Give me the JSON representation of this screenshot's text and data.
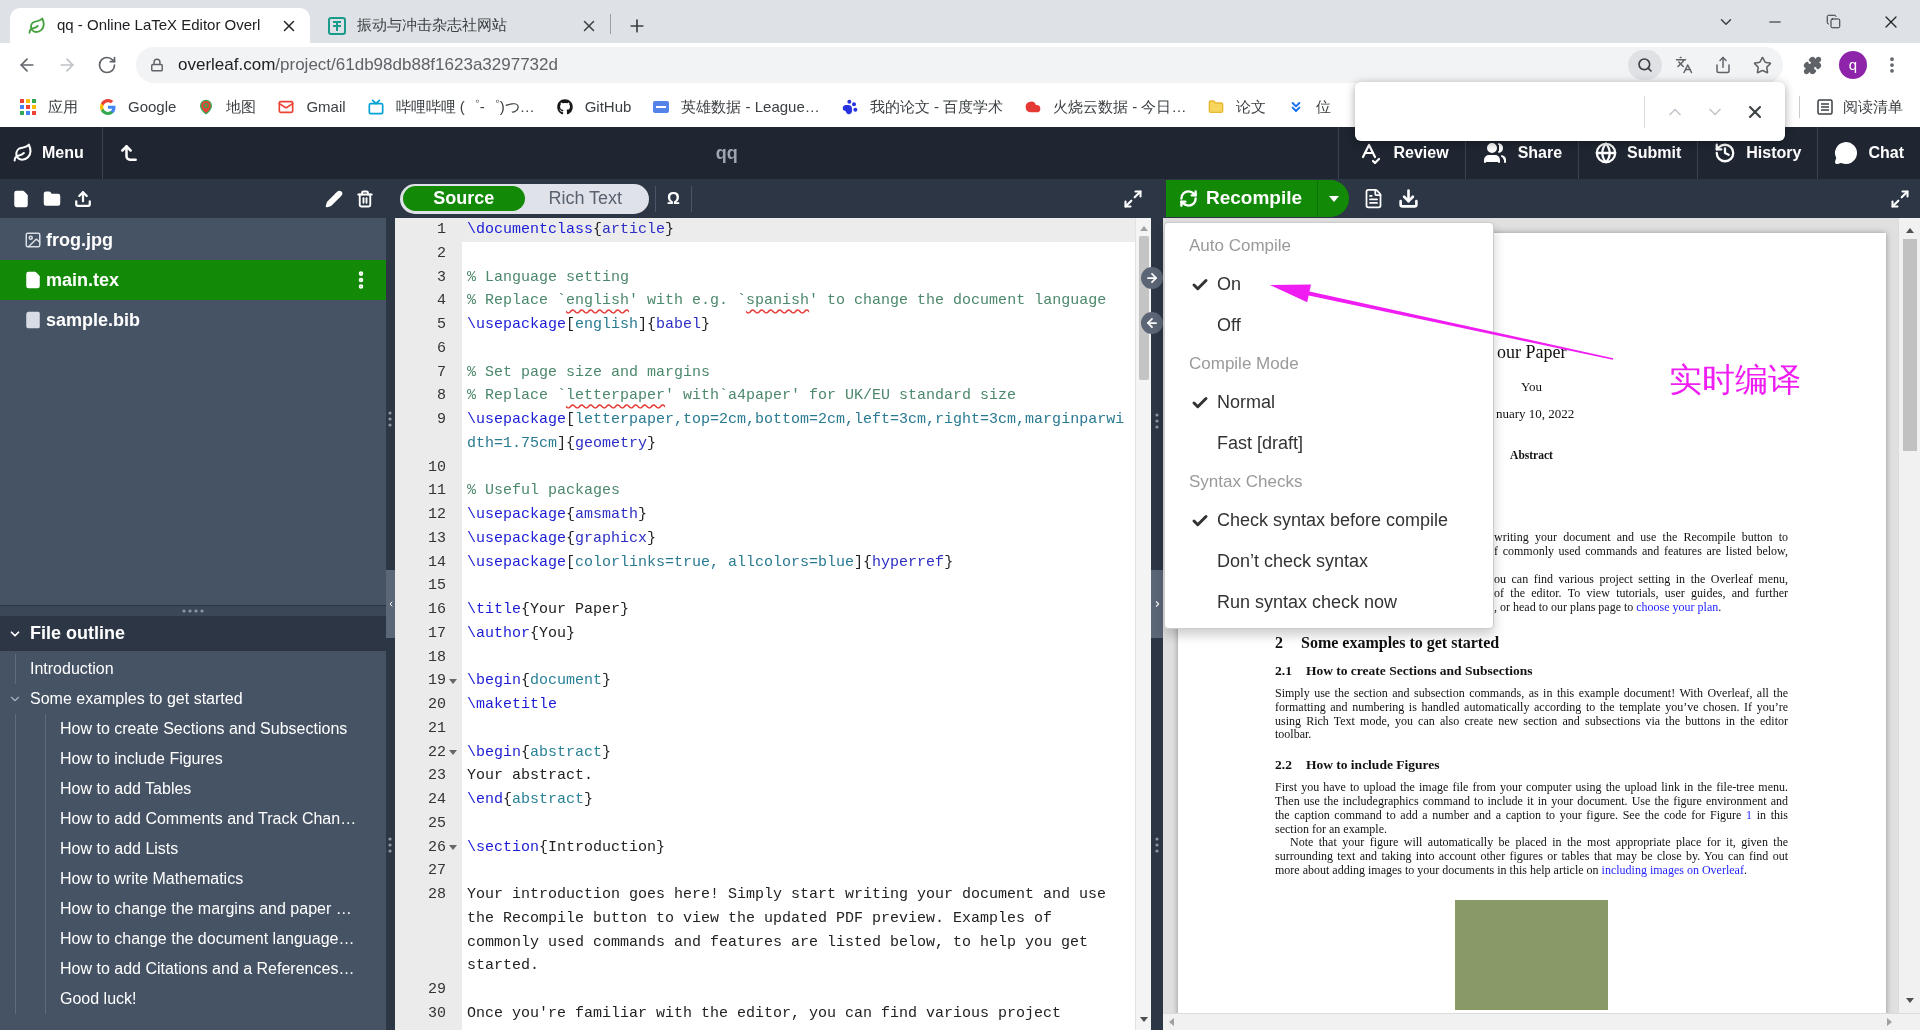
{
  "browser": {
    "tabs": [
      {
        "kind": "leaf",
        "title": "qq - Online LaTeX Editor Overl",
        "selected": true
      },
      {
        "kind": "site",
        "title": "振动与冲击杂志社网站",
        "selected": false
      }
    ],
    "nav_buttons": [
      {
        "kind": "back",
        "disabled": false
      },
      {
        "kind": "forward",
        "disabled": true
      },
      {
        "kind": "reload",
        "disabled": false
      }
    ],
    "url": {
      "host": "overleaf.com",
      "path": "/project/61db98db88f1623a3297732d"
    },
    "profile_initial": "q",
    "bookmarks": [
      {
        "kind": "apps",
        "label": "应用"
      },
      {
        "kind": "google",
        "label": "Google"
      },
      {
        "kind": "maps",
        "label": "地图"
      },
      {
        "kind": "gmail",
        "label": "Gmail"
      },
      {
        "kind": "bilibili",
        "label": "哔哩哔哩 (゜-゜)つ…"
      },
      {
        "kind": "github",
        "label": "GitHub"
      },
      {
        "kind": "opgg",
        "label": "英雄数据 - League…"
      },
      {
        "kind": "baidu",
        "label": "我的论文 - 百度学术"
      },
      {
        "kind": "cloud",
        "label": "火烧云数据 - 今日…"
      },
      {
        "kind": "folder",
        "label": "论文"
      },
      {
        "kind": "chevrons",
        "label": "位"
      }
    ],
    "reading_list": "阅读清单",
    "find_bar": {
      "buttons": [
        {
          "kind": "previous",
          "disabled": true
        },
        {
          "kind": "next",
          "disabled": true
        }
      ]
    }
  },
  "overleaf": {
    "menu_label": "Menu",
    "project_title": "qq",
    "header_buttons": [
      {
        "kind": "review",
        "label": "Review"
      },
      {
        "kind": "share",
        "label": "Share"
      },
      {
        "kind": "submit",
        "label": "Submit"
      },
      {
        "kind": "history",
        "label": "History"
      },
      {
        "kind": "chat",
        "label": "Chat"
      }
    ],
    "file_tree": [
      {
        "kind": "image",
        "name": "frog.jpg",
        "selected": false
      },
      {
        "kind": "tex",
        "name": "main.tex",
        "selected": true
      },
      {
        "kind": "bib",
        "name": "sample.bib",
        "selected": false
      }
    ],
    "outline": {
      "title": "File outline",
      "expanded": true,
      "items": [
        {
          "label": "Introduction"
        },
        {
          "label": "Some examples to get started",
          "expanded": true,
          "children": [
            {
              "label": "How to create Sections and Subsections"
            },
            {
              "label": "How to include Figures"
            },
            {
              "label": "How to add Tables"
            },
            {
              "label": "How to add Comments and Track Chan…"
            },
            {
              "label": "How to add Lists"
            },
            {
              "label": "How to write Mathematics"
            },
            {
              "label": "How to change the margins and paper …"
            },
            {
              "label": "How to change the document language…"
            },
            {
              "label": "How to add Citations and a References…"
            },
            {
              "label": "Good luck!"
            }
          ]
        }
      ]
    },
    "editor_modes": [
      {
        "label": "Source",
        "selected": true
      },
      {
        "label": "Rich Text",
        "selected": false
      }
    ],
    "symbol_button": "Ω",
    "code_lines": [
      {
        "number": "1",
        "current": true,
        "fold": false,
        "tokens": [
          {
            "kind": "cmd",
            "text": "\\documentclass"
          },
          {
            "kind": "brace",
            "text": "{"
          },
          {
            "kind": "pkg",
            "text": "article"
          },
          {
            "kind": "brace",
            "text": "}"
          }
        ]
      },
      {
        "number": "2",
        "current": false,
        "fold": false
      },
      {
        "number": "3",
        "current": false,
        "fold": false,
        "tokens": [
          {
            "kind": "comment",
            "text": "% Language setting"
          }
        ]
      },
      {
        "number": "4",
        "current": false,
        "fold": false,
        "tokens": [
          {
            "kind": "comment",
            "text": "% Replace `"
          },
          {
            "kind": "typo",
            "text": "english"
          },
          {
            "kind": "comment",
            "text": "' with e.g. `"
          },
          {
            "kind": "typo",
            "text": "spanish"
          },
          {
            "kind": "comment",
            "text": "' to change the document language"
          }
        ]
      },
      {
        "number": "5",
        "current": false,
        "fold": false,
        "tokens": [
          {
            "kind": "cmd",
            "text": "\\usepackage"
          },
          {
            "kind": "brace",
            "text": "["
          },
          {
            "kind": "opt",
            "text": "english"
          },
          {
            "kind": "brace",
            "text": "]{"
          },
          {
            "kind": "pkg",
            "text": "babel"
          },
          {
            "kind": "brace",
            "text": "}"
          }
        ]
      },
      {
        "number": "6",
        "current": false,
        "fold": false
      },
      {
        "number": "7",
        "current": false,
        "fold": false,
        "tokens": [
          {
            "kind": "comment",
            "text": "% Set page size and margins"
          }
        ]
      },
      {
        "number": "8",
        "current": false,
        "fold": false,
        "tokens": [
          {
            "kind": "comment",
            "text": "% Replace `"
          },
          {
            "kind": "typo",
            "text": "letterpaper"
          },
          {
            "kind": "comment",
            "text": "' with`a4paper' for UK/EU standard size"
          }
        ]
      },
      {
        "number": "9",
        "current": false,
        "fold": false,
        "tokens": [
          {
            "kind": "cmd",
            "text": "\\usepackage"
          },
          {
            "kind": "brace",
            "text": "["
          },
          {
            "kind": "opt",
            "text": "letterpaper,top=2cm,bottom=2cm,left=3cm,right=3cm,marginparwidth=1.75cm"
          },
          {
            "kind": "brace",
            "text": "]{"
          },
          {
            "kind": "pkg",
            "text": "geometry"
          },
          {
            "kind": "brace",
            "text": "}"
          }
        ]
      },
      {
        "number": "10",
        "current": false,
        "fold": false
      },
      {
        "number": "11",
        "current": false,
        "fold": false,
        "tokens": [
          {
            "kind": "comment",
            "text": "% Useful packages"
          }
        ]
      },
      {
        "number": "12",
        "current": false,
        "fold": false,
        "tokens": [
          {
            "kind": "cmd",
            "text": "\\usepackage"
          },
          {
            "kind": "brace",
            "text": "{"
          },
          {
            "kind": "pkg",
            "text": "amsmath"
          },
          {
            "kind": "brace",
            "text": "}"
          }
        ]
      },
      {
        "number": "13",
        "current": false,
        "fold": false,
        "tokens": [
          {
            "kind": "cmd",
            "text": "\\usepackage"
          },
          {
            "kind": "brace",
            "text": "{"
          },
          {
            "kind": "pkg",
            "text": "graphicx"
          },
          {
            "kind": "brace",
            "text": "}"
          }
        ]
      },
      {
        "number": "14",
        "current": false,
        "fold": false,
        "tokens": [
          {
            "kind": "cmd",
            "text": "\\usepackage"
          },
          {
            "kind": "brace",
            "text": "["
          },
          {
            "kind": "opt",
            "text": "colorlinks=true, allcolors=blue"
          },
          {
            "kind": "brace",
            "text": "]{"
          },
          {
            "kind": "pkg",
            "text": "hyperref"
          },
          {
            "kind": "brace",
            "text": "}"
          }
        ]
      },
      {
        "number": "15",
        "current": false,
        "fold": false
      },
      {
        "number": "16",
        "current": false,
        "fold": false,
        "tokens": [
          {
            "kind": "cmd",
            "text": "\\title"
          },
          {
            "kind": "brace",
            "text": "{"
          },
          {
            "kind": "text",
            "text": "Your Paper"
          },
          {
            "kind": "brace",
            "text": "}"
          }
        ]
      },
      {
        "number": "17",
        "current": false,
        "fold": false,
        "tokens": [
          {
            "kind": "cmd",
            "text": "\\author"
          },
          {
            "kind": "brace",
            "text": "{"
          },
          {
            "kind": "text",
            "text": "You"
          },
          {
            "kind": "brace",
            "text": "}"
          }
        ]
      },
      {
        "number": "18",
        "current": false,
        "fold": false
      },
      {
        "number": "19",
        "current": false,
        "fold": true,
        "tokens": [
          {
            "kind": "cmd",
            "text": "\\begin"
          },
          {
            "kind": "brace",
            "text": "{"
          },
          {
            "kind": "env",
            "text": "document"
          },
          {
            "kind": "brace",
            "text": "}"
          }
        ]
      },
      {
        "number": "20",
        "current": false,
        "fold": false,
        "tokens": [
          {
            "kind": "cmd",
            "text": "\\maketitle"
          }
        ]
      },
      {
        "number": "21",
        "current": false,
        "fold": false
      },
      {
        "number": "22",
        "current": false,
        "fold": true,
        "tokens": [
          {
            "kind": "cmd",
            "text": "\\begin"
          },
          {
            "kind": "brace",
            "text": "{"
          },
          {
            "kind": "env",
            "text": "abstract"
          },
          {
            "kind": "brace",
            "text": "}"
          }
        ]
      },
      {
        "number": "23",
        "current": false,
        "fold": false,
        "tokens": [
          {
            "kind": "text",
            "text": "Your abstract."
          }
        ]
      },
      {
        "number": "24",
        "current": false,
        "fold": false,
        "tokens": [
          {
            "kind": "cmd",
            "text": "\\end"
          },
          {
            "kind": "brace",
            "text": "{"
          },
          {
            "kind": "env",
            "text": "abstract"
          },
          {
            "kind": "brace",
            "text": "}"
          }
        ]
      },
      {
        "number": "25",
        "current": false,
        "fold": false
      },
      {
        "number": "26",
        "current": false,
        "fold": true,
        "tokens": [
          {
            "kind": "cmd",
            "text": "\\section"
          },
          {
            "kind": "brace",
            "text": "{"
          },
          {
            "kind": "text",
            "text": "Introduction"
          },
          {
            "kind": "brace",
            "text": "}"
          }
        ]
      },
      {
        "number": "27",
        "current": false,
        "fold": false
      },
      {
        "number": "28",
        "current": false,
        "fold": false,
        "tokens": [
          {
            "kind": "text",
            "text": "Your introduction goes here! Simply start writing your document and use the Recompile button to view the updated PDF preview. Examples of commonly used commands and features are listed below, to help you get started."
          }
        ]
      },
      {
        "number": "29",
        "current": false,
        "fold": false
      },
      {
        "number": "30",
        "current": false,
        "fold": false,
        "tokens": [
          {
            "kind": "text",
            "text": "Once you're familiar with the editor, you can find various project"
          }
        ]
      }
    ],
    "recompile_label": "Recompile",
    "compile_menu": [
      {
        "heading": "Auto Compile",
        "items": [
          {
            "label": "On",
            "checked": true
          },
          {
            "label": "Off",
            "checked": false
          }
        ]
      },
      {
        "heading": "Compile Mode",
        "items": [
          {
            "label": "Normal",
            "checked": true
          },
          {
            "label": "Fast [draft]",
            "checked": false
          }
        ]
      },
      {
        "heading": "Syntax Checks",
        "items": [
          {
            "label": "Check syntax before compile",
            "checked": true
          },
          {
            "label": "Don’t check syntax",
            "checked": false
          },
          {
            "label": "Run syntax check now",
            "checked": false
          }
        ]
      }
    ],
    "pdf": {
      "title": "our Paper",
      "author": "You",
      "date": "nuary 10, 2022",
      "abstract_heading": "Abstract",
      "clipped_paragraphs": [
        {
          "lines": [
            {
              "justified": true,
              "parts": [
                {
                  "text": "writing your document and use the Recompile button to",
                  "link": false
                }
              ]
            },
            {
              "justified": true,
              "parts": [
                {
                  "text": "f commonly used commands and features are listed below,",
                  "link": false
                }
              ]
            }
          ]
        },
        {
          "lines": [
            {
              "justified": true,
              "parts": [
                {
                  "text": "ou can find various project setting in the Overleaf menu,",
                  "link": false
                }
              ]
            },
            {
              "justified": true,
              "parts": [
                {
                  "text": "of the editor. To view tutorials, user guides, and further",
                  "link": false
                }
              ]
            },
            {
              "justified": false,
              "parts": [
                {
                  "text": ", or head to our plans page to ",
                  "link": false
                },
                {
                  "text": "choose your plan",
                  "link": true
                },
                {
                  "text": ".",
                  "link": false
                }
              ]
            }
          ]
        }
      ],
      "blocks": [
        {
          "kind": "section",
          "number": "2",
          "title": "Some examples to get started"
        },
        {
          "kind": "subsection",
          "number": "2.1",
          "title": "How to create Sections and Subsections"
        },
        {
          "kind": "paragraph",
          "indent": false,
          "parts": [
            {
              "text": "Simply use the section and subsection commands, as in this example document! With Overleaf, all the formatting and numbering is handled automatically according to the template you’ve chosen. If you’re using Rich Text mode, you can also create new section and subsections via the buttons in the editor toolbar.",
              "link": false
            }
          ]
        },
        {
          "kind": "subsection",
          "number": "2.2",
          "title": "How to include Figures"
        },
        {
          "kind": "paragraph",
          "indent": false,
          "parts": [
            {
              "text": "First you have to upload the image file from your computer using the upload link in the file-tree menu. Then use the includegraphics command to include it in your document. Use the figure environment and the caption command to add a number and a caption to your figure. See the code for Figure ",
              "link": false
            },
            {
              "text": "1",
              "link": true
            },
            {
              "text": " in this section for an example.",
              "link": false
            }
          ]
        },
        {
          "kind": "paragraph",
          "indent": true,
          "parts": [
            {
              "text": "Note that your figure will automatically be placed in the most appropriate place for it, given the surrounding text and taking into account other figures or tables that may be close by. You can find out more about adding images to your documents in this help article on ",
              "link": false
            },
            {
              "text": "including images on Overleaf",
              "link": true
            },
            {
              "text": ".",
              "link": false
            }
          ]
        },
        {
          "kind": "figure"
        }
      ]
    }
  },
  "annotation": {
    "text": "实时编译"
  }
}
